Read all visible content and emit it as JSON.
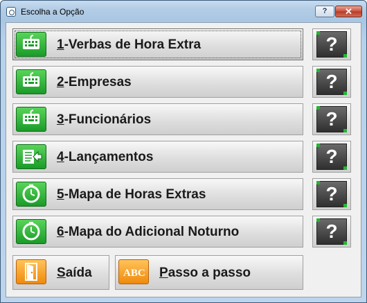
{
  "window": {
    "title": "Escolha a Opção",
    "help_glyph": "?",
    "close_glyph": "✕"
  },
  "menu": [
    {
      "num": "1",
      "text": "-Verbas de Hora Extra",
      "icon": "keyboard-icon",
      "active": true
    },
    {
      "num": "2",
      "text": "-Empresas",
      "icon": "keyboard-icon"
    },
    {
      "num": "3",
      "text": "-Funcionários",
      "icon": "keyboard-icon"
    },
    {
      "num": "4",
      "text": "-Lançamentos",
      "icon": "document-arrow-icon"
    },
    {
      "num": "5",
      "text": "-Mapa de Horas Extras",
      "icon": "clock-icon"
    },
    {
      "num": "6",
      "text": "-Mapa do Adicional Noturno",
      "icon": "clock-icon"
    }
  ],
  "help_button": {
    "glyph": "?"
  },
  "bottom": {
    "exit": {
      "key": "S",
      "text": "aída",
      "icon": "door-icon"
    },
    "steps": {
      "key": "P",
      "text": "asso a passo",
      "icon": "abc-icon",
      "icon_text": "ABC"
    }
  },
  "colors": {
    "green_icon": "#1a9b28",
    "orange_icon": "#f08a0c"
  }
}
